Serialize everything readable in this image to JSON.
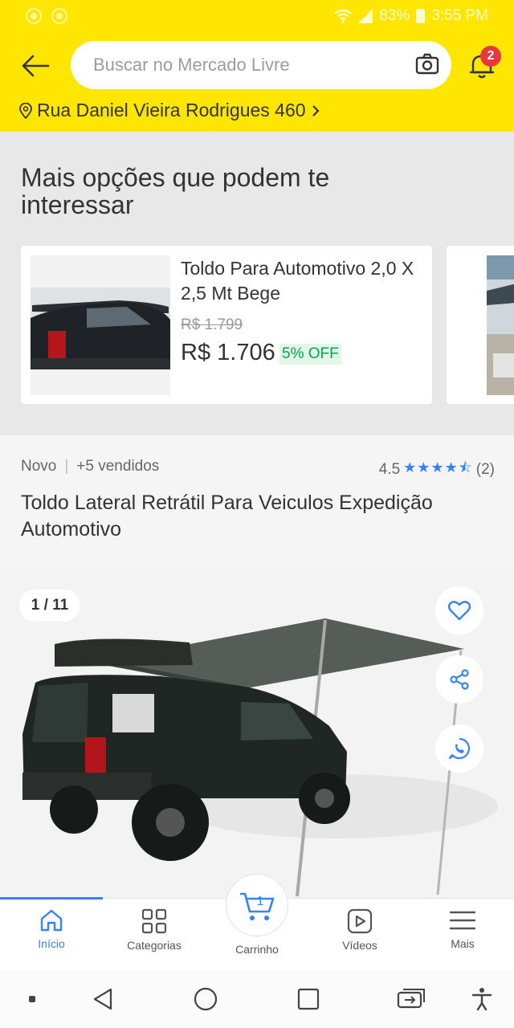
{
  "status_bar": {
    "battery": "83%",
    "time": "3:55 PM"
  },
  "header": {
    "search_placeholder": "Buscar no Mercado Livre",
    "notification_count": "2",
    "address": "Rua Daniel Vieira Rodrigues 460"
  },
  "recommendations": {
    "title": "Mais opções que podem te interessar",
    "cards": [
      {
        "title": "Toldo Para Automotivo 2,0 X 2,5 Mt Bege",
        "old_price": "R$ 1.799",
        "price": "R$ 1.706",
        "discount": "5% OFF"
      }
    ]
  },
  "product": {
    "condition": "Novo",
    "separator": "|",
    "sold": "+5 vendidos",
    "rating_value": "4.5",
    "rating_count": "(2)",
    "rating_stars": 4.5,
    "title": "Toldo Lateral Retrátil Para Veiculos Expedição Automotivo"
  },
  "gallery": {
    "counter": "1 / 11"
  },
  "bottom_nav": {
    "items": [
      {
        "label": "Início"
      },
      {
        "label": "Categorias"
      },
      {
        "label": "Carrinho"
      },
      {
        "label": "Vídeos"
      },
      {
        "label": "Mais"
      }
    ],
    "cart_count": "1"
  },
  "colors": {
    "brand_yellow": "#ffe600",
    "accent_blue": "#3483fa",
    "discount_green": "#00a650",
    "badge_red": "#e8373d"
  }
}
